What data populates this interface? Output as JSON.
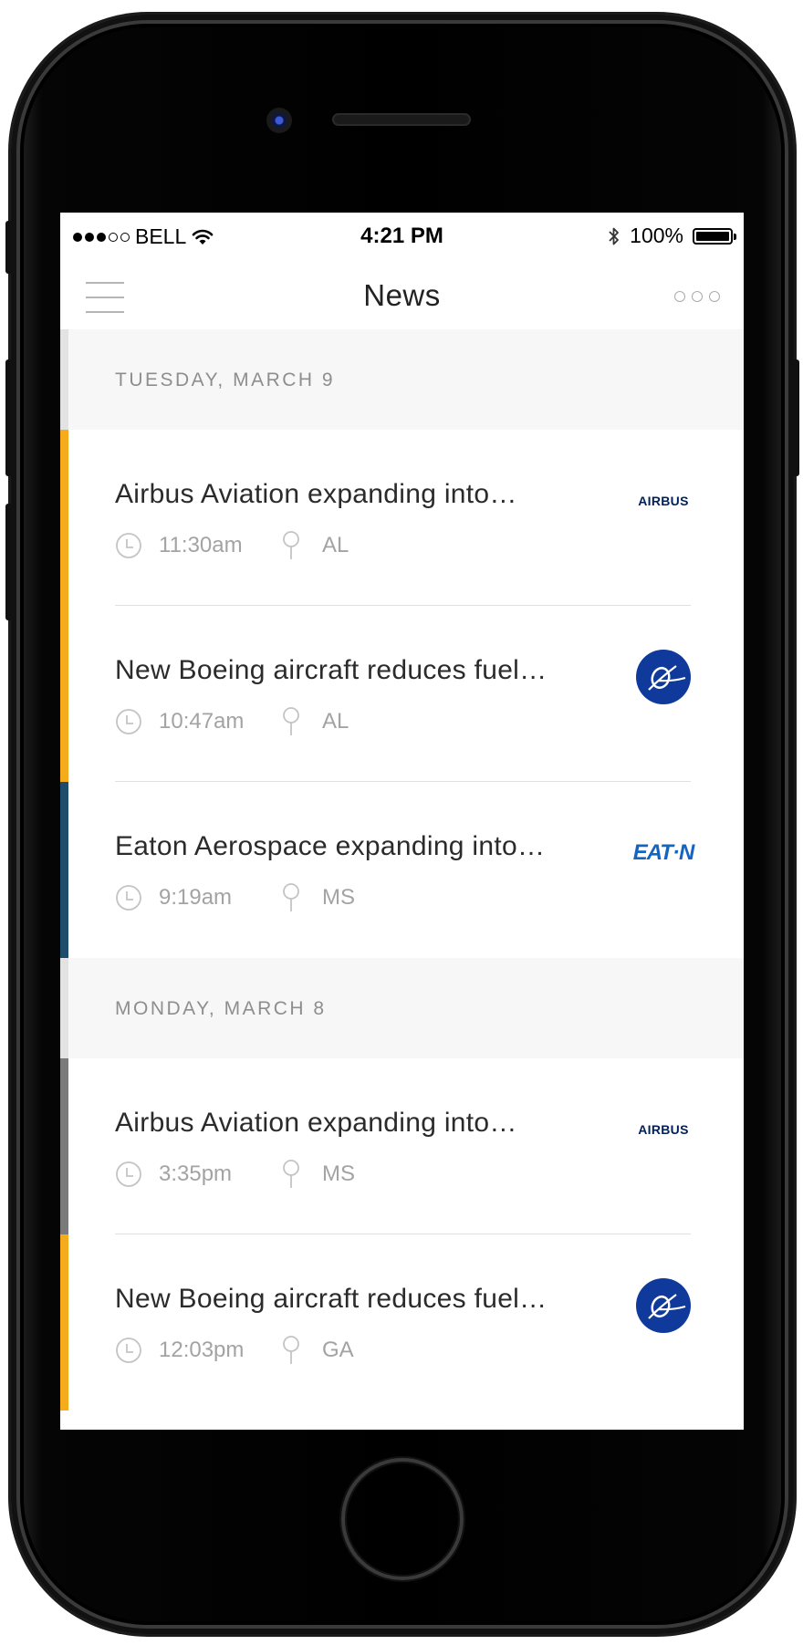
{
  "status_bar": {
    "carrier": "BELL",
    "time": "4:21 PM",
    "battery": "100%",
    "signal_bars_filled": 3,
    "signal_bars_total": 5
  },
  "nav": {
    "title": "News",
    "menu_icon": "hamburger-menu-icon",
    "more_icon": "more-dots-icon"
  },
  "colors": {
    "accent_yellow": "#f5ab1b",
    "accent_blue": "#1e4d6b",
    "accent_gray": "#7a7a7a",
    "header_stripe": "#e3e3e3"
  },
  "sections": [
    {
      "date": "TUESDAY, MARCH 9",
      "items": [
        {
          "title": "Airbus Aviation expanding into…",
          "time": "11:30am",
          "location": "AL",
          "logo": "airbus-logo",
          "logo_text": "AIRBUS",
          "accent": "#f5ab1b"
        },
        {
          "title": "New Boeing aircraft reduces fuel…",
          "time": "10:47am",
          "location": "AL",
          "logo": "boeing-logo",
          "accent": "#f5ab1b"
        },
        {
          "title": "Eaton Aerospace expanding into…",
          "time": "9:19am",
          "location": "MS",
          "logo": "eaton-logo",
          "logo_text": "EAT·N",
          "accent": "#1e4d6b"
        }
      ]
    },
    {
      "date": "MONDAY, MARCH 8",
      "items": [
        {
          "title": "Airbus Aviation expanding into…",
          "time": "3:35pm",
          "location": "MS",
          "logo": "airbus-logo",
          "logo_text": "AIRBUS",
          "accent": "#7a7a7a"
        },
        {
          "title": "New Boeing aircraft reduces fuel…",
          "time": "12:03pm",
          "location": "GA",
          "logo": "boeing-logo",
          "accent": "#f5ab1b"
        }
      ]
    }
  ]
}
